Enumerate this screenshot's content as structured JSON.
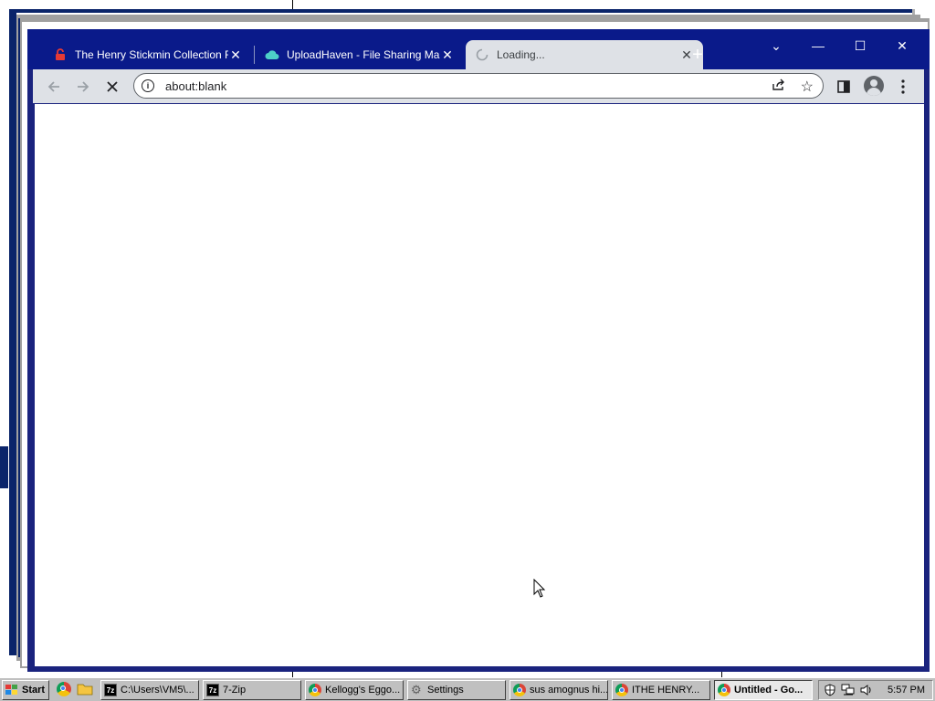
{
  "browser": {
    "tabs": [
      {
        "title": "The Henry Stickmin Collection F",
        "icon": "lock-icon",
        "active": false
      },
      {
        "title": "UploadHaven - File Sharing Ma",
        "icon": "cloud-icon",
        "active": false
      },
      {
        "title": "Loading...",
        "icon": "spinner-icon",
        "active": true
      }
    ],
    "new_tab_label": "+",
    "address": "about:blank",
    "window_controls": {
      "dropdown": "⌄",
      "minimize": "—",
      "maximize": "☐",
      "close": "✕"
    }
  },
  "taskbar": {
    "start_label": "Start",
    "buttons": [
      {
        "label": "C:\\Users\\VM5\\...",
        "icon": "7zip-icon",
        "active": false
      },
      {
        "label": "7-Zip",
        "icon": "7zip-icon",
        "active": false
      },
      {
        "label": "Kellogg's Eggo...",
        "icon": "chrome-icon",
        "active": false
      },
      {
        "label": "Settings",
        "icon": "gear-icon",
        "active": false
      },
      {
        "label": "sus amognus hi...",
        "icon": "chrome-icon",
        "active": false
      },
      {
        "label": "ITHE HENRY...",
        "icon": "chrome-icon",
        "active": false
      },
      {
        "label": "Untitled - Go...",
        "icon": "chrome-icon",
        "active": true
      }
    ],
    "clock": "5:57 PM"
  },
  "colors": {
    "titlebar": "#0a1a8a",
    "toolbar": "#dee1e6",
    "taskbar": "#c0c0c0"
  }
}
